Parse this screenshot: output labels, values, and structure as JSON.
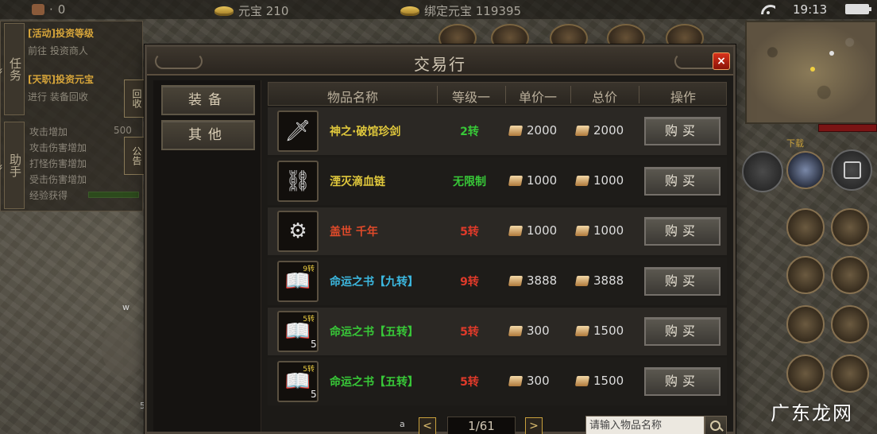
{
  "statusbar": {
    "left_value": "0",
    "yuanbao": "元宝 210",
    "bound_yuanbao": "绑定元宝 119395",
    "time": "19:13"
  },
  "quest_panel": {
    "tab_quest": "任务",
    "quest1_title": "[活动]投资等级",
    "quest1_desc": "前往 投资商人",
    "quest2_title": "[天职]投资元宝",
    "quest2_desc": "进行 装备回收",
    "side_btn_1": "回收",
    "tab_helper": "助手",
    "helper_lines": [
      "攻击增加",
      "攻击伤害增加",
      "打怪伤害增加",
      "受击伤害增加",
      "经验获得"
    ],
    "helper_value": "500",
    "side_btn_2": "公告"
  },
  "minimap": {
    "down_label": "下载"
  },
  "dialog": {
    "title": "交易行",
    "close": "×",
    "categories": [
      "装备",
      "其他"
    ],
    "columns": [
      "物品名称",
      "等级一",
      "单价一",
      "总价",
      "操作"
    ],
    "buy_label": "购买",
    "items": [
      {
        "icon": "sword-icon",
        "glyph": "🗡",
        "name": "神之·破馆珍剑",
        "name_color": "#e0c83c",
        "level": "2转",
        "level_color": "#38c838",
        "unit_price": "2000",
        "total_price": "2000",
        "badge": "",
        "qty": ""
      },
      {
        "icon": "chain-icon",
        "glyph": "⛓",
        "name": "湮灭滴血链",
        "name_color": "#e0c83c",
        "level": "无限制",
        "level_color": "#38c838",
        "unit_price": "1000",
        "total_price": "1000",
        "badge": "",
        "qty": ""
      },
      {
        "icon": "armor-icon",
        "glyph": "⚙",
        "name": "盖世 千年",
        "name_color": "#e04a2a",
        "level": "5转",
        "level_color": "#e03a2a",
        "unit_price": "1000",
        "total_price": "1000",
        "badge": "",
        "qty": ""
      },
      {
        "icon": "book-icon",
        "glyph": "📖",
        "name": "命运之书【九转】",
        "name_color": "#3cb8e0",
        "level": "9转",
        "level_color": "#e03a2a",
        "unit_price": "3888",
        "total_price": "3888",
        "badge": "9转",
        "qty": ""
      },
      {
        "icon": "book-icon",
        "glyph": "📖",
        "name": "命运之书【五转】",
        "name_color": "#38c838",
        "level": "5转",
        "level_color": "#e03a2a",
        "unit_price": "300",
        "total_price": "1500",
        "badge": "5转",
        "qty": "5"
      },
      {
        "icon": "book-icon",
        "glyph": "📖",
        "name": "命运之书【五转】",
        "name_color": "#38c838",
        "level": "5转",
        "level_color": "#e03a2a",
        "unit_price": "300",
        "total_price": "1500",
        "badge": "5转",
        "qty": "5"
      }
    ],
    "pager": {
      "prev": "<",
      "current": "1/61",
      "next": ">"
    },
    "search_placeholder": "请输入物品名称"
  },
  "watermark": "广东龙网"
}
